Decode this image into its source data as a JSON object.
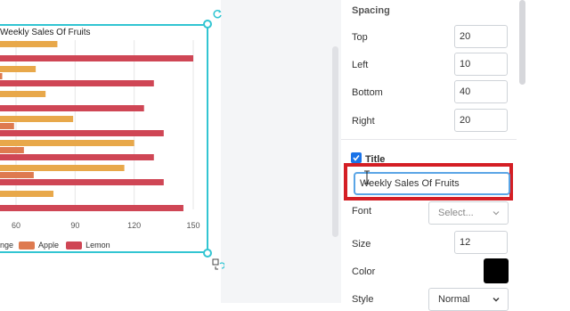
{
  "chart": {
    "title": "Weekly Sales Of Fruits",
    "x_ticks": [
      "60",
      "90",
      "120",
      "150"
    ],
    "legend": [
      {
        "label": "nge",
        "color": "#e8a84a"
      },
      {
        "label": "Apple",
        "color": "#de7a4f"
      },
      {
        "label": "Lemon",
        "color": "#cf4655"
      }
    ]
  },
  "chart_data": {
    "type": "bar",
    "orientation": "horizontal",
    "title": "Weekly Sales Of Fruits",
    "xlim": [
      0,
      160
    ],
    "x_ticks": [
      60,
      90,
      120,
      150
    ],
    "grid": true,
    "legend_position": "bottom",
    "series": [
      {
        "name": "Orange",
        "color": "#e8a84a",
        "values": [
          81,
          70,
          75,
          89,
          120,
          115,
          79
        ]
      },
      {
        "name": "Apple",
        "color": "#de7a4f",
        "values": [
          null,
          53,
          null,
          59,
          64,
          69,
          null
        ]
      },
      {
        "name": "Lemon",
        "color": "#cf4655",
        "values": [
          150,
          130,
          125,
          135,
          130,
          135,
          145
        ]
      }
    ]
  },
  "panel": {
    "spacing_title": "Spacing",
    "top_label": "Top",
    "top_value": "20",
    "left_label": "Left",
    "left_value": "10",
    "bottom_label": "Bottom",
    "bottom_value": "40",
    "right_label": "Right",
    "right_value": "20",
    "title_section": "Title",
    "title_value": "Weekly Sales Of Fruits",
    "font_label": "Font",
    "font_placeholder": "Select...",
    "size_label": "Size",
    "size_value": "12",
    "color_label": "Color",
    "color_value": "#000000",
    "style_label": "Style",
    "style_value": "Normal"
  }
}
